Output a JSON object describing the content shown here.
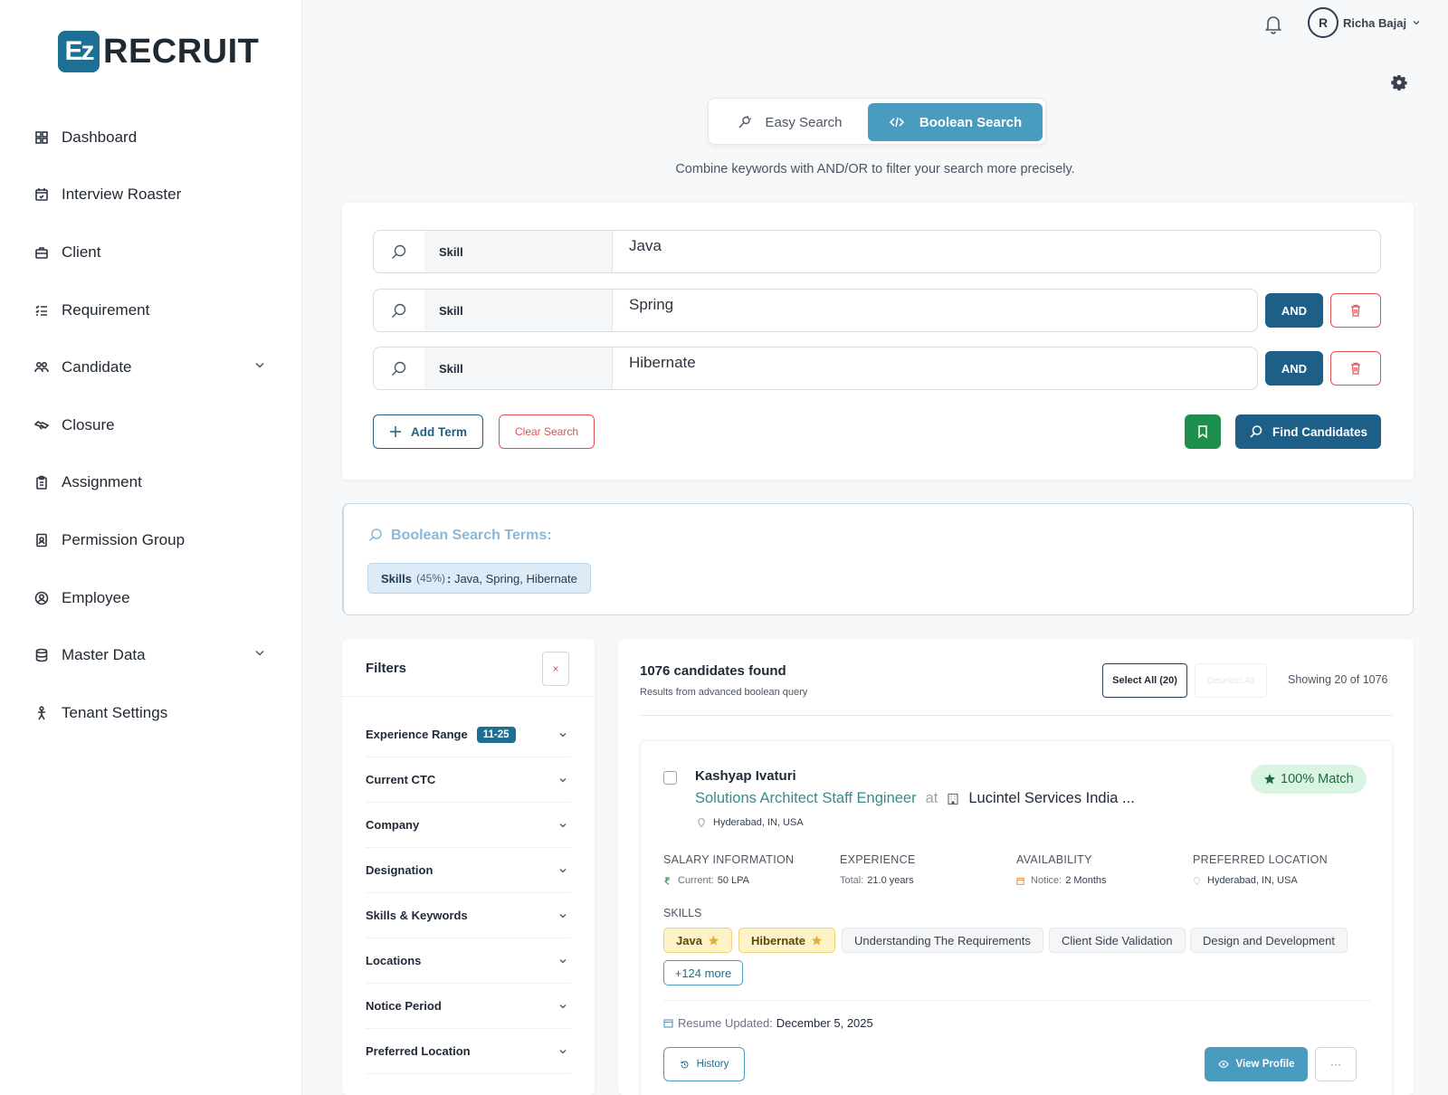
{
  "brand": {
    "logo_mark": "Ez",
    "logo_text": "RECRUIT"
  },
  "sidebar": {
    "items": [
      {
        "label": "Dashboard",
        "icon": "grid-icon"
      },
      {
        "label": "Interview Roaster",
        "icon": "calendar-check-icon"
      },
      {
        "label": "Client",
        "icon": "briefcase-icon"
      },
      {
        "label": "Requirement",
        "icon": "list-check-icon"
      },
      {
        "label": "Candidate",
        "icon": "users-icon",
        "expandable": true
      },
      {
        "label": "Closure",
        "icon": "handshake-icon"
      },
      {
        "label": "Assignment",
        "icon": "clipboard-icon"
      },
      {
        "label": "Permission Group",
        "icon": "id-badge-icon"
      },
      {
        "label": "Employee",
        "icon": "user-circle-icon"
      },
      {
        "label": "Master Data",
        "icon": "database-icon",
        "expandable": true
      },
      {
        "label": "Tenant Settings",
        "icon": "person-gear-icon"
      }
    ]
  },
  "header": {
    "user_initial": "R",
    "user_name": "Richa Bajaj"
  },
  "search_mode": {
    "easy_label": "Easy Search",
    "boolean_label": "Boolean Search",
    "active": "boolean",
    "subtitle": "Combine keywords with AND/OR to filter your search more precisely."
  },
  "query": {
    "rows": [
      {
        "field": "Skill",
        "value": "Java"
      },
      {
        "field": "Skill",
        "value": "Spring",
        "operator": "AND"
      },
      {
        "field": "Skill",
        "value": "Hibernate",
        "operator": "AND"
      }
    ],
    "add_term_label": "Add Term",
    "clear_label": "Clear Search",
    "find_label": "Find Candidates"
  },
  "terms": {
    "title": "Boolean Search Terms:",
    "chip_key": "Skills",
    "chip_pct": "(45%)",
    "chip_values": "Java, Spring, Hibernate"
  },
  "filters": {
    "title": "Filters",
    "close_glyph": "×",
    "items": [
      {
        "label": "Experience Range",
        "badge": "11-25"
      },
      {
        "label": "Current CTC"
      },
      {
        "label": "Company"
      },
      {
        "label": "Designation"
      },
      {
        "label": "Skills & Keywords"
      },
      {
        "label": "Locations"
      },
      {
        "label": "Notice Period"
      },
      {
        "label": "Preferred Location"
      }
    ]
  },
  "results": {
    "count_text": "1076 candidates found",
    "sub_text": "Results from advanced boolean query",
    "select_all_label": "Select All (20)",
    "deselect_label": "Deselect All",
    "showing_text": "Showing 20 of 1076"
  },
  "candidate": {
    "name": "Kashyap Ivaturi",
    "title": "Solutions Architect Staff Engineer",
    "at": "at",
    "company": "Lucintel Services India ...",
    "location": "Hyderabad, IN, USA",
    "match": "100% Match",
    "salary_head": "SALARY INFORMATION",
    "salary_key": "Current:",
    "salary_val": "50 LPA",
    "exp_head": "EXPERIENCE",
    "exp_key": "Total:",
    "exp_val": "21.0 years",
    "avail_head": "AVAILABILITY",
    "avail_key": "Notice:",
    "avail_val": "2 Months",
    "pref_head": "PREFERRED LOCATION",
    "pref_val": "Hyderabad, IN, USA",
    "skills_head": "SKILLS",
    "skills": [
      "Java",
      "Hibernate",
      "Understanding The Requirements",
      "Client Side Validation",
      "Design and Development"
    ],
    "more_label": "+124 more",
    "resume_key": "Resume Updated:",
    "resume_date": "December 5, 2025",
    "history_label": "History",
    "view_label": "View Profile",
    "dots_label": "···"
  },
  "colors": {
    "accent": "#4a9bc0",
    "primary": "#1d5f86",
    "danger": "#e05252",
    "success": "#1f8f4e"
  }
}
